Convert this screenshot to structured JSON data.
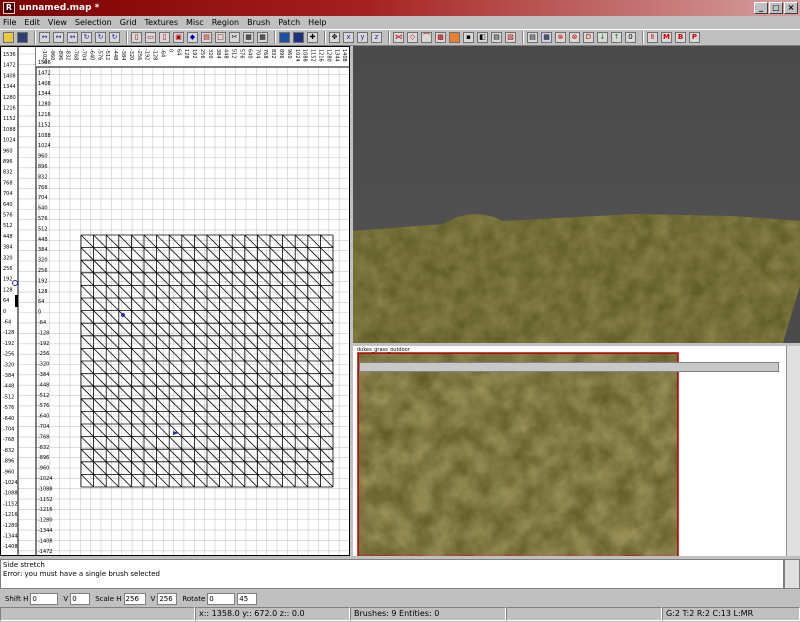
{
  "window": {
    "title": "unnamed.map *"
  },
  "menu": [
    "File",
    "Edit",
    "View",
    "Selection",
    "Grid",
    "Textures",
    "Misc",
    "Region",
    "Brush",
    "Patch",
    "Help"
  ],
  "toolbar": {
    "icons": [
      "open-icon",
      "save-icon",
      "flip-x-icon",
      "flip-y-icon",
      "flip-z-icon",
      "rotate-x-icon",
      "rotate-y-icon",
      "rotate-z-icon",
      "select-complete-tall-icon",
      "select-touching-icon",
      "select-partial-tall-icon",
      "select-inside-icon",
      "csg-subtract-icon",
      "csg-merge-icon",
      "hollow-icon",
      "clipper-icon",
      "change-view-icon",
      "texture-view-icon",
      "camera-icon",
      "cubic-clip-icon",
      "entity-view-icon",
      "move-icon",
      "scale-x-icon",
      "scale-y-icon",
      "scale-z-icon",
      "drag-edges-icon",
      "drag-vertices-icon",
      "patch-bend-icon",
      "patch-insert-icon",
      "patch-delete-icon",
      "patch-cap-icon",
      "show-entities-icon",
      "texture-lock-icon",
      "rotation-lock-icon",
      "filter-icon",
      "plugin-icon",
      "plugin-icon-2",
      "plugin-icon-3",
      "plugin-icon-4",
      "plugin-icon-5",
      "plugin-icon-6",
      "plugin-icon-7"
    ],
    "letters": {
      "x": "x",
      "y": "y",
      "z": "z",
      "d": "D",
      "m": "M",
      "b": "B",
      "p": "P",
      "zero": "0"
    }
  },
  "grid": {
    "top_labels": [
      "-1024",
      "-960",
      "-896",
      "-832",
      "-768",
      "-704",
      "-640",
      "-576",
      "-512",
      "-448",
      "-384",
      "-320",
      "-256",
      "-192",
      "-128",
      "-64",
      "0",
      "64",
      "128",
      "192",
      "256",
      "320",
      "384",
      "448",
      "512",
      "576",
      "640",
      "704",
      "768",
      "832",
      "896",
      "960",
      "1024",
      "1088",
      "1152",
      "1216",
      "1280",
      "1344",
      "1408",
      "1472",
      "1536"
    ],
    "left_labels_a": [
      "1536",
      "1472",
      "1408",
      "1344",
      "1280",
      "1216",
      "1152",
      "1088",
      "1024",
      "960",
      "896",
      "832",
      "768",
      "704",
      "640",
      "576",
      "512",
      "448",
      "384",
      "320",
      "256",
      "192",
      "128",
      "64",
      "0",
      "-64",
      "-128",
      "-192",
      "-256",
      "-320",
      "-384",
      "-448",
      "-512",
      "-576",
      "-640",
      "-704",
      "-768",
      "-832",
      "-896",
      "-960",
      "-1024",
      "-1088",
      "-1152",
      "-1216",
      "-1280",
      "-1344",
      "-1408",
      "-1472",
      "-1536"
    ],
    "left_labels_b": [
      "1536",
      "1472",
      "1408",
      "1344",
      "1280",
      "1216",
      "1152",
      "1088",
      "1024",
      "960",
      "896",
      "832",
      "768",
      "704",
      "640",
      "576",
      "512",
      "448",
      "384",
      "320",
      "256",
      "192",
      "128",
      "64",
      "0",
      "-64",
      "-128",
      "-192",
      "-256",
      "-320",
      "-384",
      "-448",
      "-512",
      "-576",
      "-640",
      "-704",
      "-768",
      "-832",
      "-896",
      "-960",
      "-1024",
      "-1088",
      "-1152",
      "-1216",
      "-1280",
      "-1344",
      "-1408",
      "-1472",
      "-1536"
    ]
  },
  "texture_window": {
    "title": "dukes_grass_outdoor"
  },
  "console": {
    "lines": [
      "Side stretch",
      "Error: you must have a single brush selected"
    ]
  },
  "surface": {
    "shift_h_label": "Shift H",
    "shift_h": "0",
    "shift_v_label": "V",
    "shift_v": "0",
    "scale_h_label": "Scale H",
    "scale_h": "256",
    "scale_v_label": "V",
    "scale_v": "256",
    "rotate_label": "Rotate",
    "rotate": "0",
    "rotate_step": "45"
  },
  "status": {
    "empty": "",
    "coords": "x:: 1358.0  y:: 672.0  z:: 0.0",
    "counts": "Brushes: 9  Entities: 0",
    "grid": "G:2 T:2 R:2 C:13 L:MR"
  },
  "colors": {
    "title_start": "#7c0000",
    "title_end": "#d6a0a0",
    "grid_line": "#c8c8c8",
    "brush": "#000000",
    "terrain": "#5a5520"
  }
}
